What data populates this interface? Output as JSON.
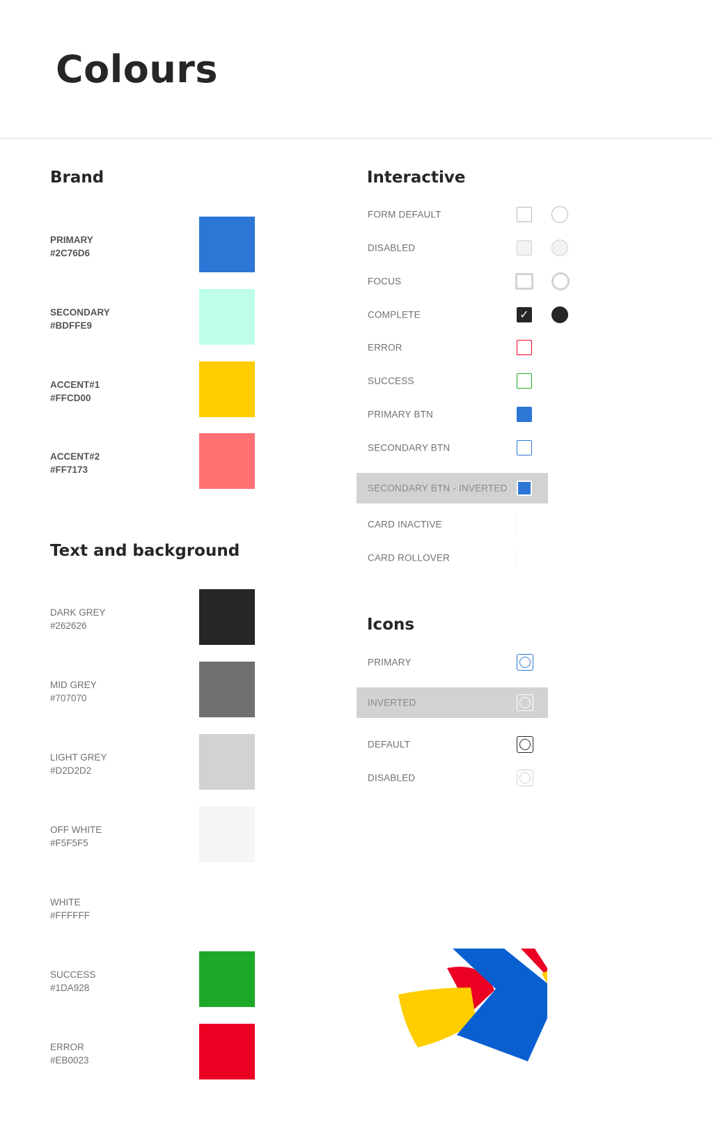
{
  "page": {
    "title": "Colours"
  },
  "brand": {
    "title": "Brand",
    "swatches": [
      {
        "name": "PRIMARY",
        "hex": "#2C76D6"
      },
      {
        "name": "SECONDARY",
        "hex": "#BDFFE9"
      },
      {
        "name": "ACCENT#1",
        "hex": "#FFCD00"
      },
      {
        "name": "ACCENT#2",
        "hex": "#FF7173"
      }
    ]
  },
  "text_background": {
    "title": "Text and background",
    "swatches": [
      {
        "name": "DARK GREY",
        "hex": "#262626"
      },
      {
        "name": "MID GREY",
        "hex": "#707070"
      },
      {
        "name": "LIGHT GREY",
        "hex": "#D2D2D2"
      },
      {
        "name": "OFF WHITE",
        "hex": "#F5F5F5"
      },
      {
        "name": "WHITE",
        "hex": "#FFFFFF"
      },
      {
        "name": "SUCCESS",
        "hex": "#1DA928"
      },
      {
        "name": "ERROR",
        "hex": "#EB0023"
      }
    ]
  },
  "interactive": {
    "title": "Interactive",
    "rows": [
      {
        "label": "FORM DEFAULT"
      },
      {
        "label": "DISABLED"
      },
      {
        "label": "FOCUS"
      },
      {
        "label": "COMPLETE",
        "check_glyph": "✓"
      },
      {
        "label": "ERROR"
      },
      {
        "label": "SUCCESS"
      },
      {
        "label": "PRIMARY BTN"
      },
      {
        "label": "SECONDARY BTN"
      },
      {
        "label": "SECONDARY BTN - INVERTED"
      },
      {
        "label": "CARD INACTIVE"
      },
      {
        "label": "CARD ROLLOVER"
      }
    ]
  },
  "icons": {
    "title": "Icons",
    "rows": [
      {
        "label": "PRIMARY"
      },
      {
        "label": "INVERTED"
      },
      {
        "label": "DEFAULT"
      },
      {
        "label": "DISABLED"
      }
    ]
  },
  "colors": {
    "primary": "#2C76D6",
    "secondary": "#BDFFE9",
    "accent1": "#FFCD00",
    "accent2": "#FF7173",
    "dark_grey": "#262626",
    "mid_grey": "#707070",
    "light_grey": "#D2D2D2",
    "off_white": "#F5F5F5",
    "white": "#FFFFFF",
    "success": "#1DA928",
    "error": "#EB0023"
  }
}
